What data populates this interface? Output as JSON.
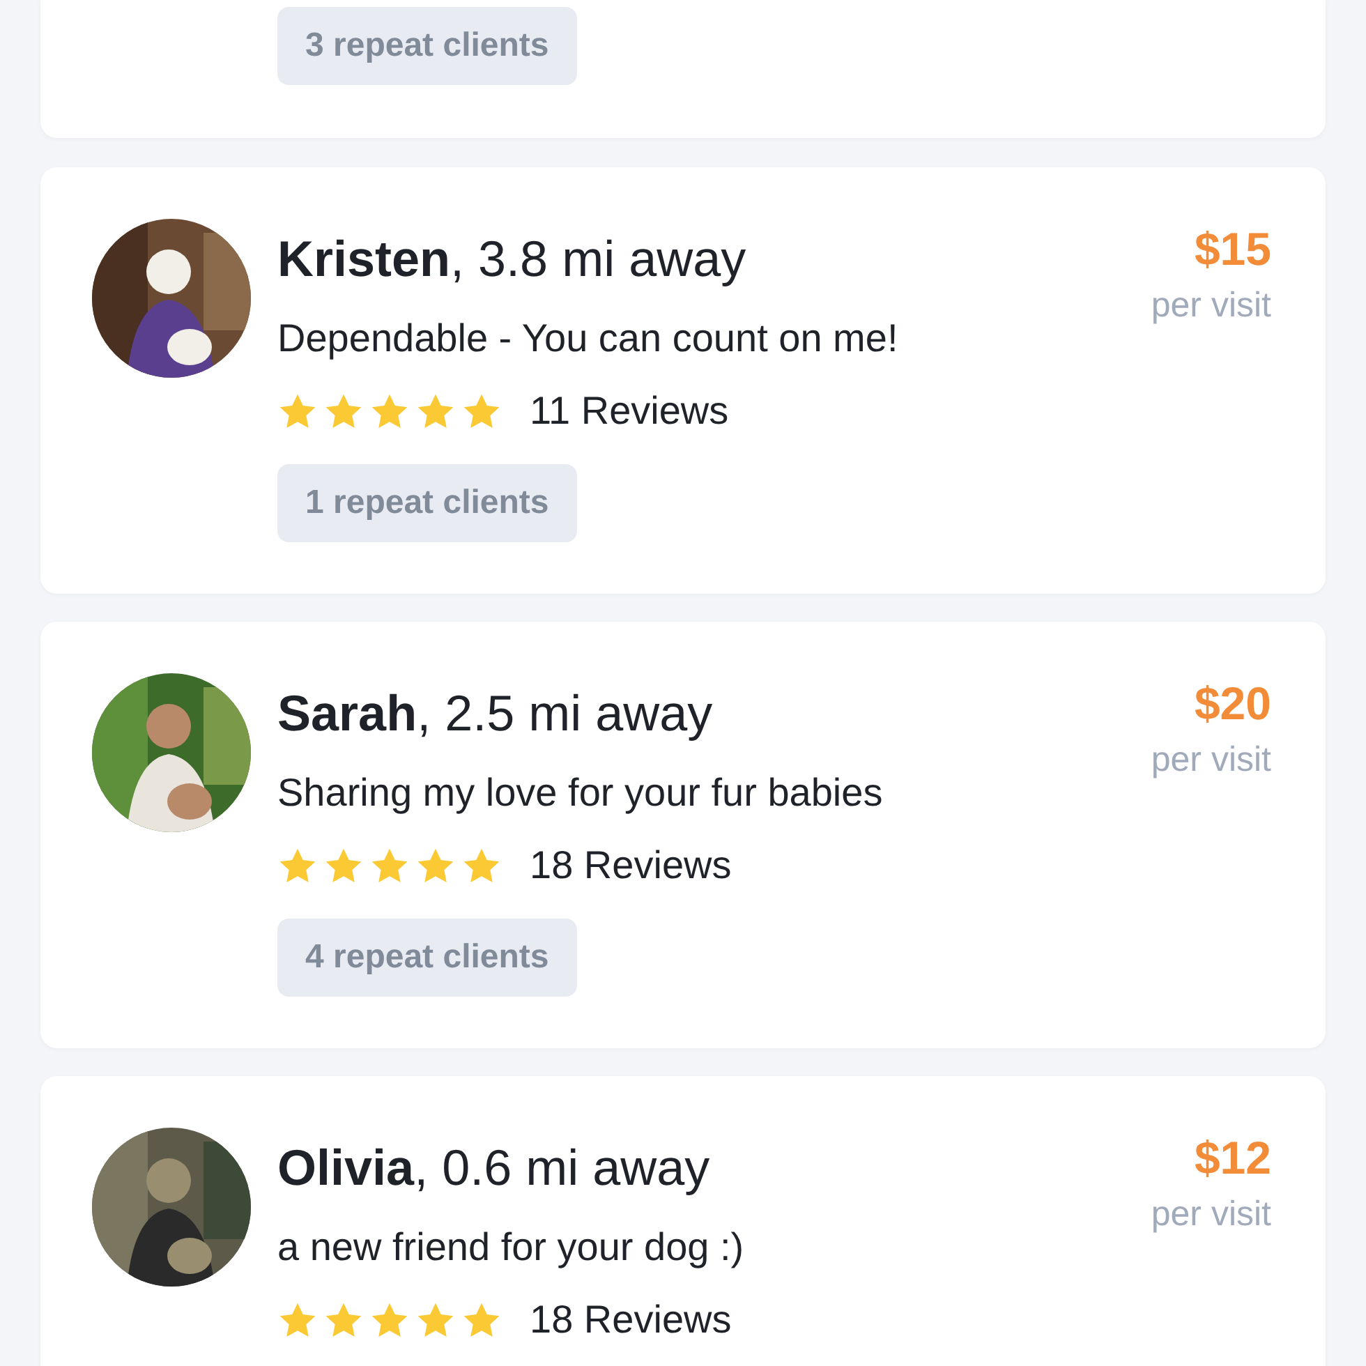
{
  "cut_card": {
    "repeat_clients": "3 repeat clients"
  },
  "sitters": [
    {
      "name": "**Kristen**, 3.8 mi away",
      "tagline": "Dependable - You can count on me!",
      "stars": 5,
      "reviews": "11 Reviews",
      "repeat_clients": "1 repeat clients",
      "price": "$15",
      "price_unit": "per visit"
    },
    {
      "name": "**Sarah**, 2.5 mi away",
      "tagline": "Sharing my love for your fur babies",
      "stars": 5,
      "reviews": "18 Reviews",
      "repeat_clients": "4 repeat clients",
      "price": "$20",
      "price_unit": "per visit"
    },
    {
      "name": "**Olivia**, 0.6 mi away",
      "tagline": "a new friend for your dog :)",
      "stars": 5,
      "reviews": "18 Reviews",
      "price": "$12",
      "price_unit": "per visit"
    }
  ]
}
